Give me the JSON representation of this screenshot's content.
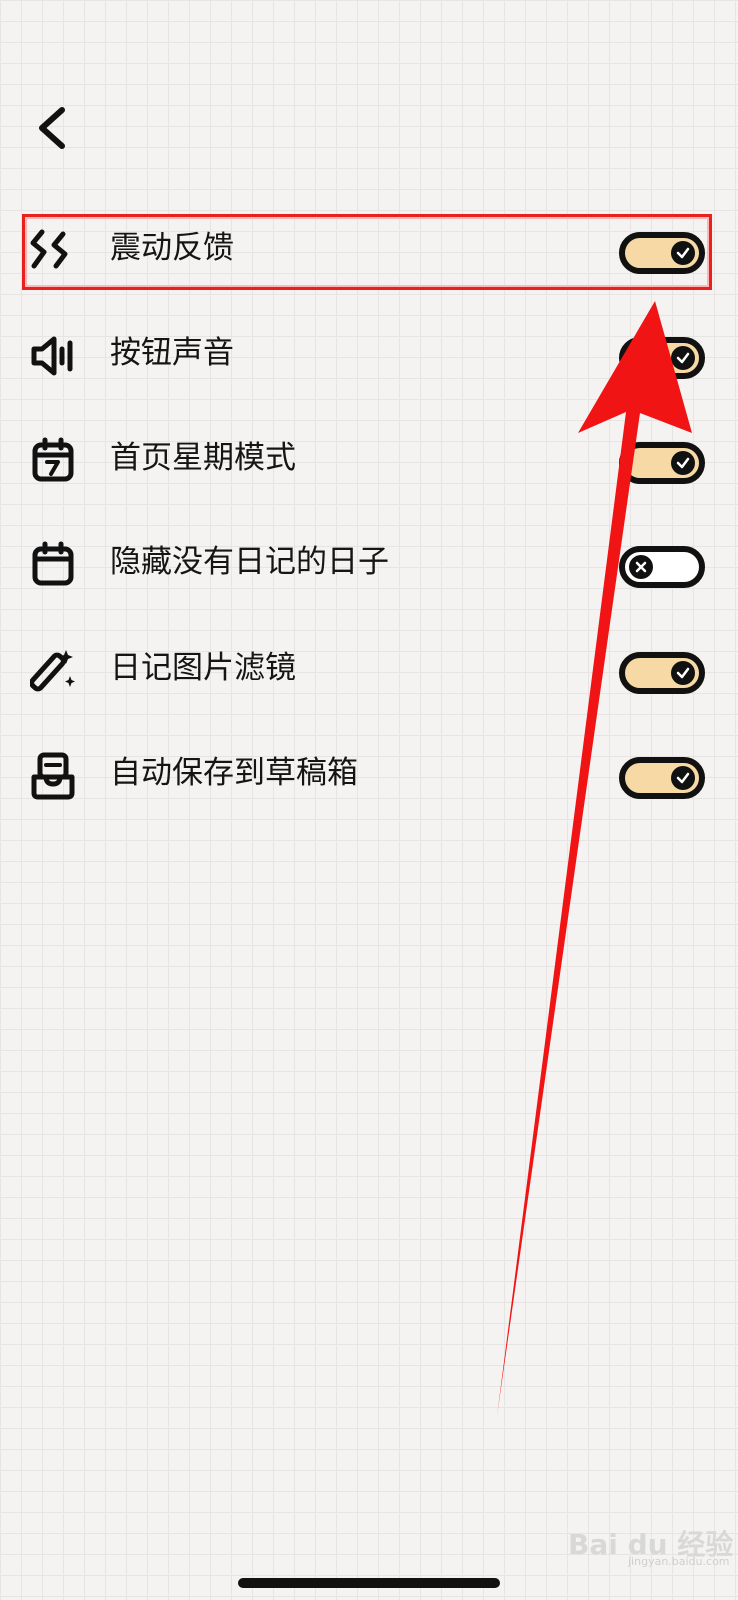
{
  "header": {
    "back_icon": "chevron-left-icon"
  },
  "settings": [
    {
      "label": "震动反馈",
      "icon": "vibration-icon",
      "enabled": true
    },
    {
      "label": "按钮声音",
      "icon": "speaker-icon",
      "enabled": true
    },
    {
      "label": "首页星期模式",
      "icon": "calendar-7-icon",
      "enabled": true
    },
    {
      "label": "隐藏没有日记的日子",
      "icon": "calendar-icon",
      "enabled": false
    },
    {
      "label": "日记图片滤镜",
      "icon": "magic-wand-icon",
      "enabled": true
    },
    {
      "label": "自动保存到草稿箱",
      "icon": "drafts-inbox-icon",
      "enabled": true
    }
  ],
  "colors": {
    "toggle_on": "#f6d9a4",
    "toggle_off": "#ffffff",
    "annotation": "#e8201e"
  },
  "watermark": {
    "text": "Bai du 经验",
    "sub": "jingyan.baidu.com"
  }
}
